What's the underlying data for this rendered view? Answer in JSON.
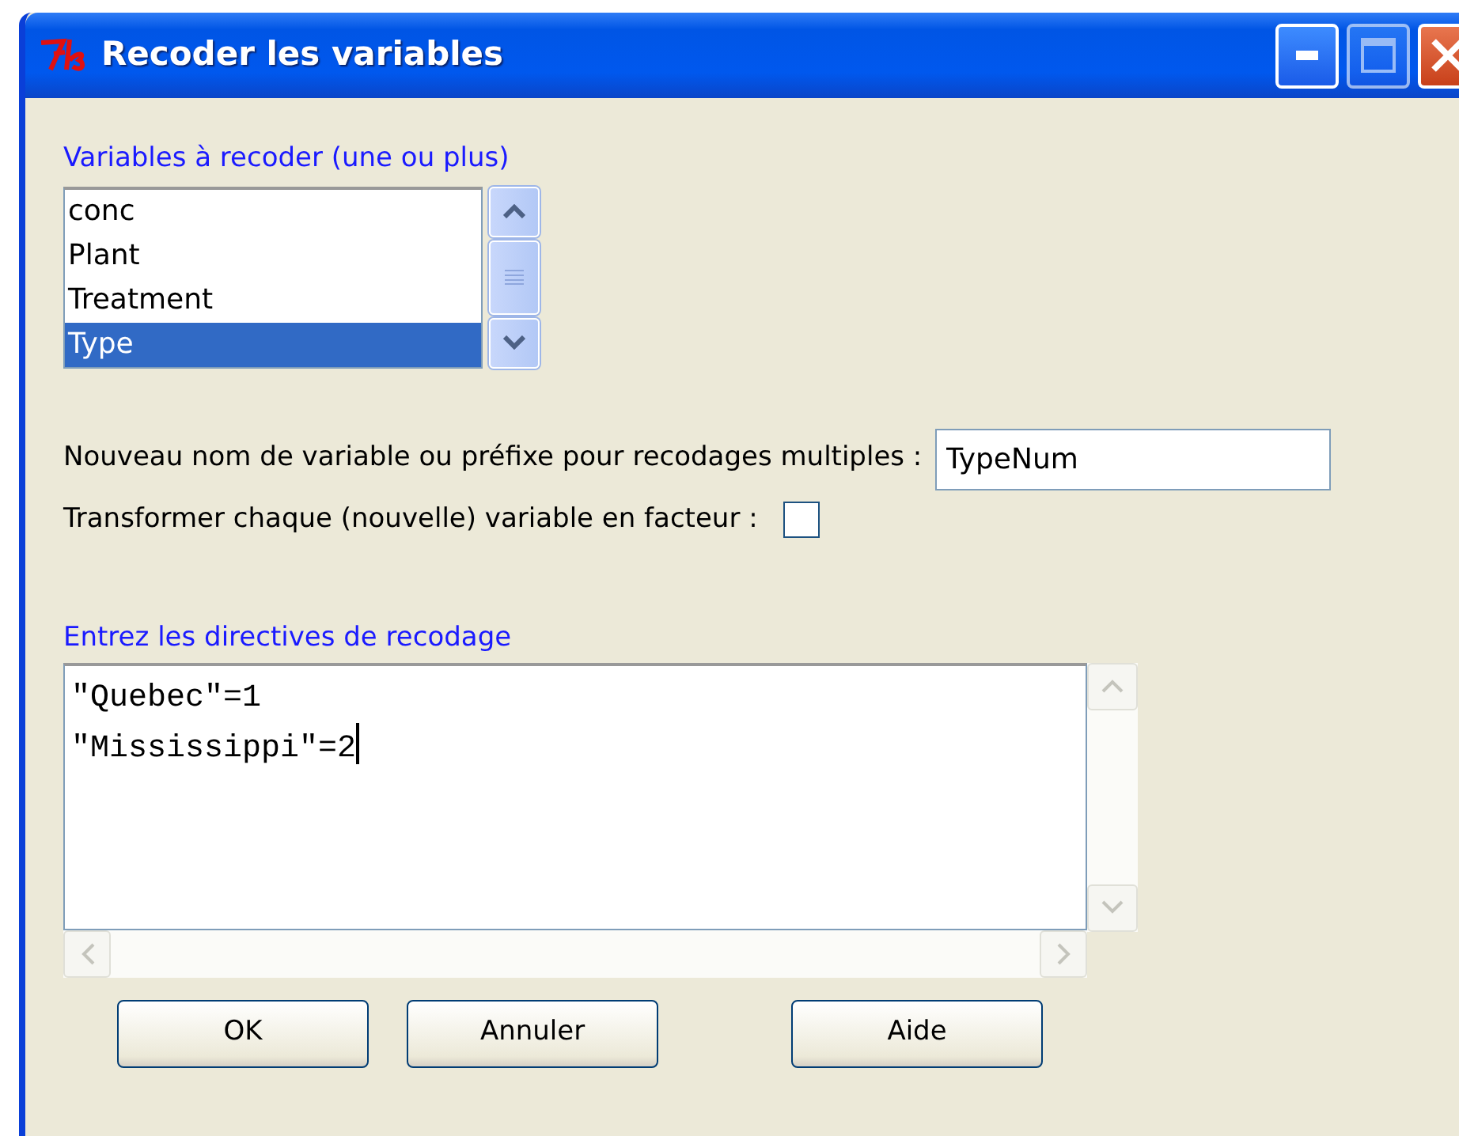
{
  "window": {
    "title": "Recoder les variables"
  },
  "variables": {
    "label": "Variables à recoder (une ou plus)",
    "items": [
      {
        "label": "conc",
        "selected": false
      },
      {
        "label": "Plant",
        "selected": false
      },
      {
        "label": "Treatment",
        "selected": false
      },
      {
        "label": "Type",
        "selected": true
      }
    ]
  },
  "new_name": {
    "label": "Nouveau nom de variable ou préfixe pour recodages multiples :",
    "value": "TypeNum"
  },
  "factor": {
    "label": "Transformer chaque (nouvelle) variable en facteur :",
    "checked": false
  },
  "directives": {
    "label": "Entrez les directives de recodage",
    "lines": [
      "\"Quebec\"=1",
      "\"Mississippi\"=2"
    ]
  },
  "buttons": [
    {
      "label": "OK"
    },
    {
      "label": "Annuler"
    },
    {
      "label": "Aide"
    }
  ]
}
